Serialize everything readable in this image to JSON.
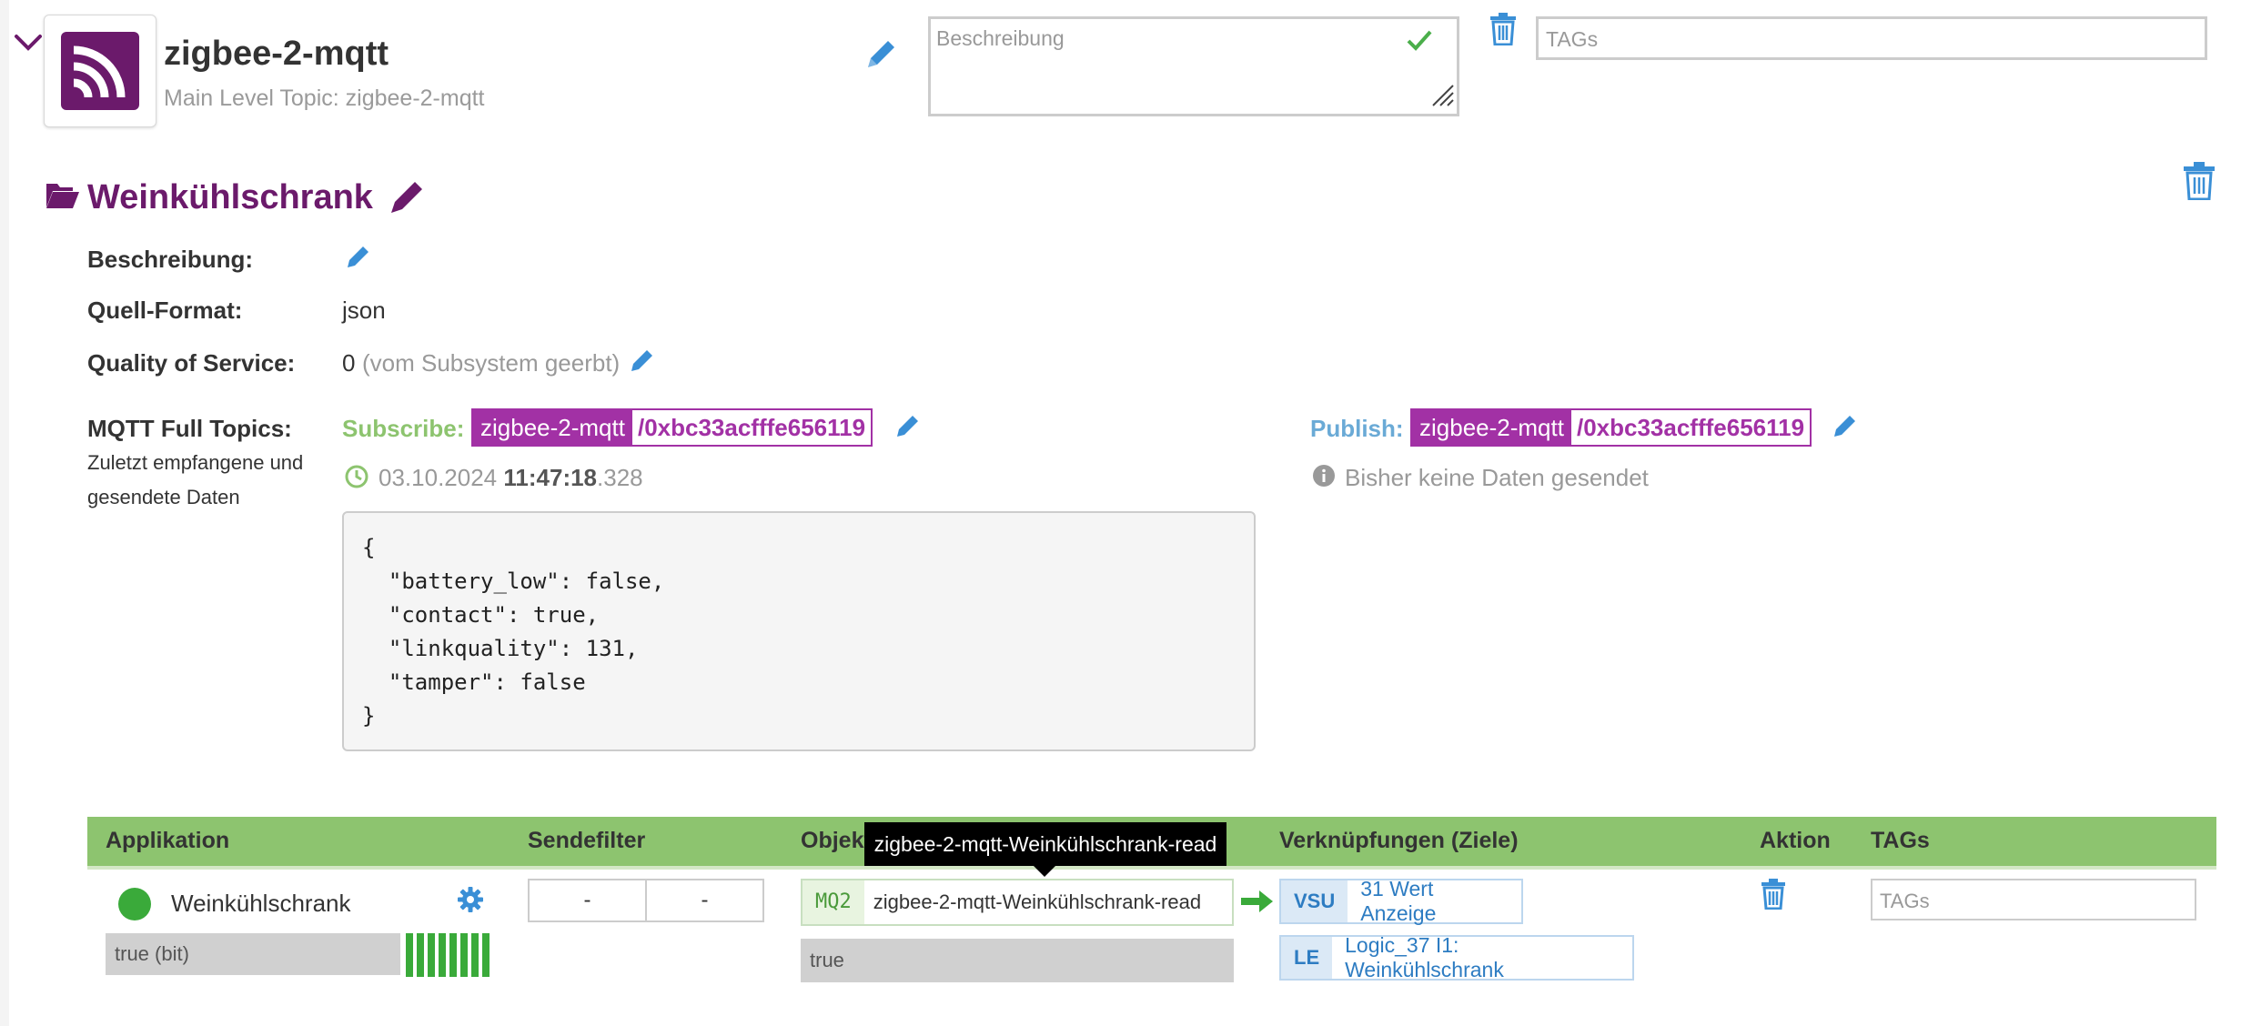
{
  "header": {
    "name": "zigbee-2-mqtt",
    "topic_label": "Main Level Topic: zigbee-2-mqtt",
    "description_placeholder": "Beschreibung",
    "tags_placeholder": "TAGs"
  },
  "topic": {
    "title": "Weinkühlschrank",
    "fields": {
      "beschreibung_label": "Beschreibung:",
      "format_label": "Quell-Format:",
      "format_value": "json",
      "qos_label": "Quality of Service:",
      "qos_value": "0",
      "qos_note": "(vom Subsystem geerbt)",
      "mqtt_label": "MQTT Full Topics:",
      "mqtt_sub1": "Zuletzt empfangene und",
      "mqtt_sub2": "gesendete Daten"
    },
    "subscribe": {
      "label": "Subscribe:",
      "base": "zigbee-2-mqtt",
      "path": "/0xbc33acfffe656119",
      "ts_date": "03.10.2024",
      "ts_time": "11:47:18",
      "ts_ms": ".328"
    },
    "publish": {
      "label": "Publish:",
      "base": "zigbee-2-mqtt",
      "path": "/0xbc33acfffe656119",
      "status": "Bisher keine Daten gesendet"
    },
    "payload": "{\n  \"battery_low\": false,\n  \"contact\": true,\n  \"linkquality\": 131,\n  \"tamper\": false\n}"
  },
  "table": {
    "headers": {
      "app": "Applikation",
      "filter": "Sendefilter",
      "obj": "Objekt",
      "links": "Verknüpfungen (Ziele)",
      "action": "Aktion",
      "tags": "TAGs"
    },
    "tooltip": "zigbee-2-mqtt-Weinkühlschrank-read",
    "row": {
      "app_name": "Weinkühlschrank",
      "app_value": "true (bit)",
      "filter_a": "-",
      "filter_b": "-",
      "obj_code": "MQ2",
      "obj_name": "zigbee-2-mqtt-Weinkühlschrank-read",
      "obj_value": "true",
      "links": [
        {
          "kind": "VSU",
          "text": "31 Wert Anzeige"
        },
        {
          "kind": "LE",
          "text": "Logic_37 I1: Weinkühlschrank"
        }
      ],
      "tags_placeholder": "TAGs"
    }
  },
  "colors": {
    "brand": "#6b1a6b",
    "topic_pill": "#a231a5",
    "table_header": "#8dc46f",
    "link_blue": "#2d7cc2",
    "status_green": "#3aaa3a"
  }
}
